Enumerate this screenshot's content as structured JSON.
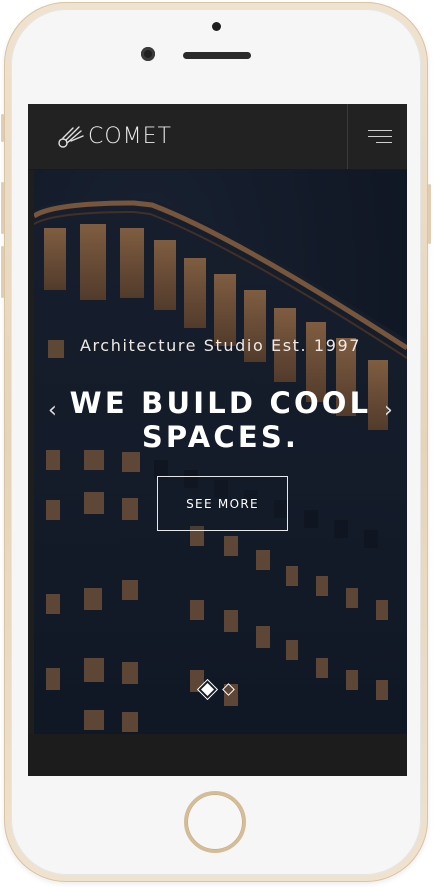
{
  "nav": {
    "logo_text": "COMET",
    "logo_icon": "comet-icon",
    "menu_icon": "hamburger-menu-icon"
  },
  "hero": {
    "subtitle": "Architecture Studio Est. 1997",
    "headline_line1": "WE BUILD COOL",
    "headline_line2": "SPACES.",
    "cta_label": "SEE MORE",
    "prev_arrow": "‹",
    "next_arrow": "›",
    "slides_total": 2,
    "slide_active": 1
  },
  "colors": {
    "topbar": "#222222",
    "hero_bg": "#141c2b",
    "window_light": "#c98a4e",
    "phone_frame": "#e7d3b8"
  }
}
